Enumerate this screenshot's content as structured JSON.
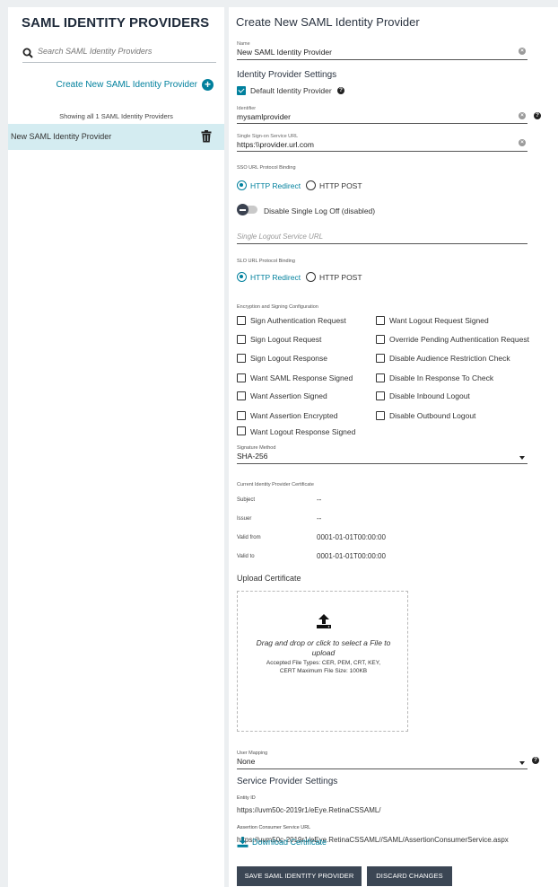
{
  "sidebar": {
    "title": "SAML IDENTITY PROVIDERS",
    "search_placeholder": "Search SAML Identity Providers",
    "create_label": "Create New SAML Identity Provider",
    "showing_text": "Showing all 1 SAML Identity Providers",
    "items": [
      {
        "label": "New SAML Identity Provider"
      }
    ]
  },
  "main": {
    "title": "Create New SAML Identity Provider",
    "name": {
      "label": "Name",
      "value": "New SAML Identity Provider"
    },
    "idp_section": "Identity Provider Settings",
    "default_idp_label": "Default Identity Provider",
    "identifier": {
      "label": "Identifier",
      "value": "mysamlprovider"
    },
    "sso_url": {
      "label": "Single Sign-on Service URL",
      "value": "https:\\\\provider.url.com"
    },
    "sso_binding": {
      "label": "SSO URL Protocol Binding",
      "options": [
        "HTTP Redirect",
        "HTTP POST"
      ],
      "selected": "HTTP Redirect"
    },
    "single_logoff_label": "Disable Single Log Off (disabled)",
    "slo_url_placeholder": "Single Logout Service URL",
    "slo_binding": {
      "label": "SLO URL Protocol Binding",
      "options": [
        "HTTP Redirect",
        "HTTP POST"
      ],
      "selected": "HTTP Redirect"
    },
    "encryption_label": "Encryption and Signing Configuration",
    "encryption_left": [
      "Sign Authentication Request",
      "Sign Logout Request",
      "Sign Logout Response",
      "Want SAML Response Signed",
      "Want Assertion Signed",
      "Want Assertion Encrypted",
      "Want Logout Response Signed"
    ],
    "encryption_right": [
      "Want Logout Request Signed",
      "Override Pending Authentication Request",
      "Disable Audience Restriction Check",
      "Disable In Response To Check",
      "Disable Inbound Logout",
      "Disable Outbound Logout"
    ],
    "signature": {
      "label": "Signature Method",
      "value": "SHA-256"
    },
    "certificate": {
      "label": "Current Identity Provider Certificate",
      "rows": [
        {
          "key": "Subject",
          "value": "--"
        },
        {
          "key": "Issuer",
          "value": "--"
        },
        {
          "key": "Valid from",
          "value": "0001-01-01T00:00:00"
        },
        {
          "key": "Valid to",
          "value": "0001-01-01T00:00:00"
        }
      ]
    },
    "upload": {
      "title": "Upload Certificate",
      "main_text": "Drag and drop or click to select a File to upload",
      "sub_text": "Accepted File Types: CER, PEM, CRT, KEY, CERT Maximum File Size: 100KB"
    },
    "user_mapping": {
      "label": "User Mapping",
      "value": "None"
    },
    "sp_section": "Service Provider Settings",
    "entity_id": {
      "label": "Entity ID",
      "value": "https://uvm50c-2019r1/eEye.RetinaCSSAML/"
    },
    "acs_url": {
      "label": "Assertion Consumer Service URL",
      "value": "https://uvm50c-2019r1/eEye.RetinaCSSAML//SAML/AssertionConsumerService.aspx"
    },
    "download_label": "Download Certificate",
    "save_label": "SAVE SAML IDENTITY PROVIDER",
    "discard_label": "DISCARD CHANGES"
  },
  "colors": {
    "accent": "#00809d",
    "selected_row": "#d4ecf1",
    "button": "#3b4654"
  }
}
